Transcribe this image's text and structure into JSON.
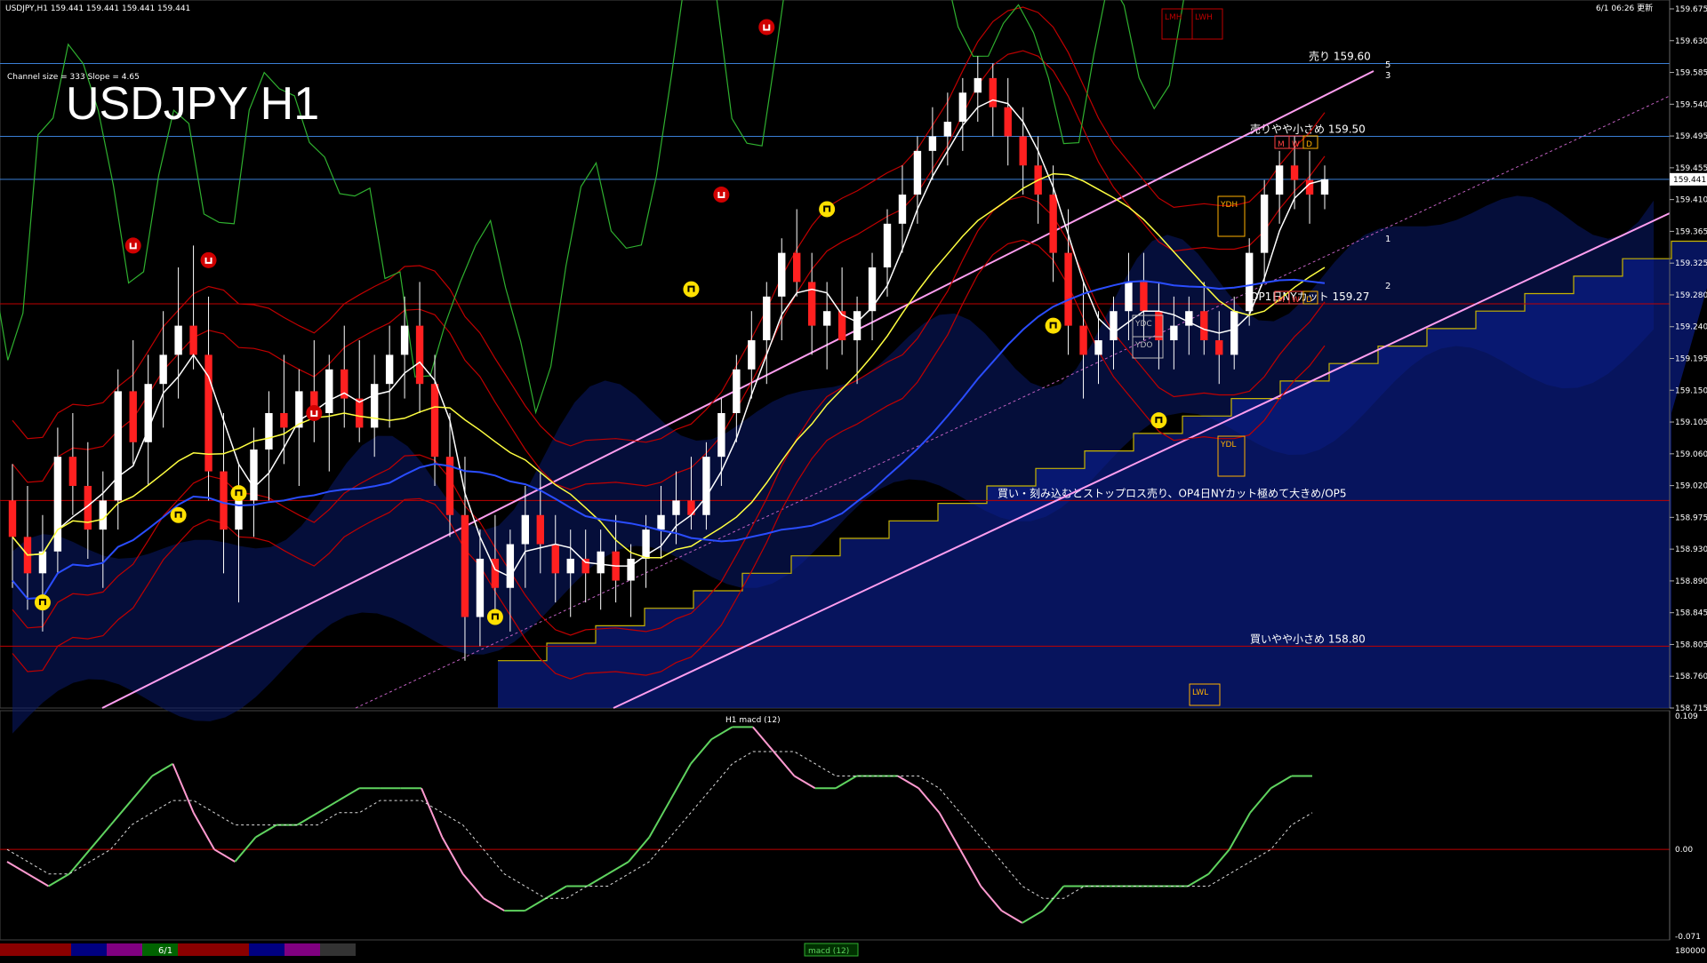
{
  "header": {
    "symbol_line": "USDJPY,H1  159.441 159.441 159.441 159.441",
    "datetime": "6/1 06:26 更新",
    "channel_info": "Channel size = 333 Slope = 4.65",
    "big_title": "USDJPY H1",
    "current_price": "159.441"
  },
  "levels": [
    {
      "label": "売り 159.60",
      "price": 159.6,
      "color": "#3a7fd5"
    },
    {
      "label": "売りやや小さめ 159.50",
      "price": 159.5,
      "color": "#3a7fd5"
    },
    {
      "label": "",
      "price": 159.441,
      "color": "#3a7fd5"
    },
    {
      "label": "OP1日NYカット 159.27",
      "price": 159.27,
      "color": "#c00000"
    },
    {
      "label": "買い・刻み込むとストップロス売り、OP4日NYカット極めて大きめ/OP5",
      "price": 159.0,
      "color": "#c00000"
    },
    {
      "label": "買いやや小さめ 158.80",
      "price": 158.8,
      "color": "#c00000"
    }
  ],
  "box_labels": [
    "LMH",
    "LWH",
    "YDH",
    "YDL",
    "YDC",
    "YDO",
    "LWL",
    "M",
    "W",
    "D",
    "M",
    "W",
    "D"
  ],
  "channel_numbers": [
    "5",
    "3",
    "1",
    "2"
  ],
  "chart_data": [
    {
      "type": "candlestick",
      "title": "USDJPY H1",
      "ylim": [
        158.715,
        159.675
      ],
      "y_ticks": [
        "159.675",
        "159.630",
        "159.585",
        "159.540",
        "159.495",
        "159.455",
        "159.410",
        "159.365",
        "159.325",
        "159.280",
        "159.240",
        "159.195",
        "159.150",
        "159.105",
        "159.060",
        "159.020",
        "158.975",
        "158.930",
        "158.890",
        "158.845",
        "158.805",
        "158.760",
        "158.715"
      ],
      "ohlc": [
        [
          159.0,
          159.05,
          158.88,
          158.95
        ],
        [
          158.95,
          159.02,
          158.85,
          158.9
        ],
        [
          158.9,
          158.98,
          158.82,
          158.93
        ],
        [
          158.93,
          159.1,
          158.9,
          159.06
        ],
        [
          159.06,
          159.12,
          158.98,
          159.02
        ],
        [
          159.02,
          159.08,
          158.92,
          158.96
        ],
        [
          158.96,
          159.04,
          158.88,
          159.0
        ],
        [
          159.0,
          159.18,
          158.96,
          159.15
        ],
        [
          159.15,
          159.22,
          159.05,
          159.08
        ],
        [
          159.08,
          159.2,
          159.02,
          159.16
        ],
        [
          159.16,
          159.26,
          159.1,
          159.2
        ],
        [
          159.2,
          159.32,
          159.14,
          159.24
        ],
        [
          159.24,
          159.35,
          159.18,
          159.2
        ],
        [
          159.2,
          159.28,
          159.0,
          159.04
        ],
        [
          159.04,
          159.12,
          158.9,
          158.96
        ],
        [
          158.96,
          159.05,
          158.86,
          159.0
        ],
        [
          159.0,
          159.1,
          158.95,
          159.07
        ],
        [
          159.07,
          159.15,
          159.0,
          159.12
        ],
        [
          159.12,
          159.2,
          159.05,
          159.1
        ],
        [
          159.1,
          159.18,
          159.02,
          159.15
        ],
        [
          159.15,
          159.22,
          159.08,
          159.12
        ],
        [
          159.12,
          159.2,
          159.04,
          159.18
        ],
        [
          159.18,
          159.24,
          159.1,
          159.14
        ],
        [
          159.14,
          159.22,
          159.08,
          159.1
        ],
        [
          159.1,
          159.2,
          159.06,
          159.16
        ],
        [
          159.16,
          159.24,
          159.1,
          159.2
        ],
        [
          159.2,
          159.28,
          159.14,
          159.24
        ],
        [
          159.24,
          159.3,
          159.12,
          159.16
        ],
        [
          159.16,
          159.2,
          159.02,
          159.06
        ],
        [
          159.06,
          159.12,
          158.95,
          158.98
        ],
        [
          158.98,
          159.06,
          158.78,
          158.84
        ],
        [
          158.84,
          158.96,
          158.8,
          158.92
        ],
        [
          158.92,
          158.98,
          158.84,
          158.88
        ],
        [
          158.88,
          158.96,
          158.82,
          158.94
        ],
        [
          158.94,
          159.02,
          158.88,
          158.98
        ],
        [
          158.98,
          159.04,
          158.9,
          158.94
        ],
        [
          158.94,
          158.98,
          158.86,
          158.9
        ],
        [
          158.9,
          158.96,
          158.84,
          158.92
        ],
        [
          158.92,
          158.96,
          158.86,
          158.9
        ],
        [
          158.9,
          158.96,
          158.85,
          158.93
        ],
        [
          158.93,
          158.98,
          158.86,
          158.89
        ],
        [
          158.89,
          158.94,
          158.84,
          158.92
        ],
        [
          158.92,
          158.98,
          158.88,
          158.96
        ],
        [
          158.96,
          159.02,
          158.92,
          158.98
        ],
        [
          158.98,
          159.04,
          158.94,
          159.0
        ],
        [
          159.0,
          159.06,
          158.96,
          158.98
        ],
        [
          158.98,
          159.08,
          158.96,
          159.06
        ],
        [
          159.06,
          159.14,
          159.02,
          159.12
        ],
        [
          159.12,
          159.2,
          159.08,
          159.18
        ],
        [
          159.18,
          159.26,
          159.14,
          159.22
        ],
        [
          159.22,
          159.3,
          159.16,
          159.28
        ],
        [
          159.28,
          159.36,
          159.22,
          159.34
        ],
        [
          159.34,
          159.4,
          159.28,
          159.3
        ],
        [
          159.3,
          159.34,
          159.2,
          159.24
        ],
        [
          159.24,
          159.3,
          159.18,
          159.26
        ],
        [
          159.26,
          159.32,
          159.2,
          159.22
        ],
        [
          159.22,
          159.28,
          159.16,
          159.26
        ],
        [
          159.26,
          159.34,
          159.22,
          159.32
        ],
        [
          159.32,
          159.4,
          159.28,
          159.38
        ],
        [
          159.38,
          159.46,
          159.34,
          159.42
        ],
        [
          159.42,
          159.5,
          159.38,
          159.48
        ],
        [
          159.48,
          159.54,
          159.44,
          159.5
        ],
        [
          159.5,
          159.56,
          159.46,
          159.52
        ],
        [
          159.52,
          159.58,
          159.48,
          159.56
        ],
        [
          159.56,
          159.61,
          159.52,
          159.58
        ],
        [
          159.58,
          159.6,
          159.5,
          159.54
        ],
        [
          159.54,
          159.58,
          159.46,
          159.5
        ],
        [
          159.5,
          159.54,
          159.42,
          159.46
        ],
        [
          159.46,
          159.5,
          159.38,
          159.42
        ],
        [
          159.42,
          159.46,
          159.3,
          159.34
        ],
        [
          159.34,
          159.4,
          159.2,
          159.24
        ],
        [
          159.24,
          159.3,
          159.14,
          159.2
        ],
        [
          159.2,
          159.26,
          159.16,
          159.22
        ],
        [
          159.22,
          159.28,
          159.18,
          159.26
        ],
        [
          159.26,
          159.34,
          159.22,
          159.3
        ],
        [
          159.3,
          159.34,
          159.22,
          159.26
        ],
        [
          159.26,
          159.3,
          159.18,
          159.22
        ],
        [
          159.22,
          159.28,
          159.18,
          159.24
        ],
        [
          159.24,
          159.28,
          159.2,
          159.26
        ],
        [
          159.26,
          159.3,
          159.2,
          159.22
        ],
        [
          159.22,
          159.26,
          159.16,
          159.2
        ],
        [
          159.2,
          159.28,
          159.18,
          159.26
        ],
        [
          159.26,
          159.36,
          159.24,
          159.34
        ],
        [
          159.34,
          159.44,
          159.3,
          159.42
        ],
        [
          159.42,
          159.48,
          159.38,
          159.46
        ],
        [
          159.46,
          159.5,
          159.4,
          159.44
        ],
        [
          159.44,
          159.48,
          159.38,
          159.42
        ],
        [
          159.42,
          159.46,
          159.4,
          159.441
        ]
      ]
    },
    {
      "type": "line",
      "title": "H1 macd (12)",
      "ylim": [
        -0.071,
        0.109
      ],
      "y_ticks": [
        "0.109",
        "0.00",
        "-0.071"
      ],
      "series": [
        {
          "values": [
            -0.01,
            -0.02,
            -0.03,
            -0.02,
            0.0,
            0.02,
            0.04,
            0.06,
            0.07,
            0.03,
            0.0,
            -0.01,
            0.01,
            0.02,
            0.02,
            0.03,
            0.04,
            0.05,
            0.05,
            0.05,
            0.05,
            0.01,
            -0.02,
            -0.04,
            -0.05,
            -0.05,
            -0.04,
            -0.03,
            -0.03,
            -0.02,
            -0.01,
            0.01,
            0.04,
            0.07,
            0.09,
            0.1,
            0.1,
            0.08,
            0.06,
            0.05,
            0.05,
            0.06,
            0.06,
            0.06,
            0.05,
            0.03,
            0.0,
            -0.03,
            -0.05,
            -0.06,
            -0.05,
            -0.03,
            -0.03,
            -0.03,
            -0.03,
            -0.03,
            -0.03,
            -0.03,
            -0.02,
            0.0,
            0.03,
            0.05,
            0.06,
            0.06
          ],
          "color": "#5fd35f"
        },
        {
          "values": [
            0.0,
            -0.01,
            -0.02,
            -0.02,
            -0.01,
            0.0,
            0.02,
            0.03,
            0.04,
            0.04,
            0.03,
            0.02,
            0.02,
            0.02,
            0.02,
            0.02,
            0.03,
            0.03,
            0.04,
            0.04,
            0.04,
            0.03,
            0.02,
            0.0,
            -0.02,
            -0.03,
            -0.04,
            -0.04,
            -0.03,
            -0.03,
            -0.02,
            -0.01,
            0.01,
            0.03,
            0.05,
            0.07,
            0.08,
            0.08,
            0.08,
            0.07,
            0.06,
            0.06,
            0.06,
            0.06,
            0.06,
            0.05,
            0.03,
            0.01,
            -0.01,
            -0.03,
            -0.04,
            -0.04,
            -0.03,
            -0.03,
            -0.03,
            -0.03,
            -0.03,
            -0.03,
            -0.03,
            -0.02,
            -0.01,
            0.0,
            0.02,
            0.03
          ],
          "color": "#cccccc"
        }
      ]
    }
  ],
  "footer": {
    "date_label": "6/1",
    "indicator_label": "macd (12)",
    "right_value": "180000"
  }
}
